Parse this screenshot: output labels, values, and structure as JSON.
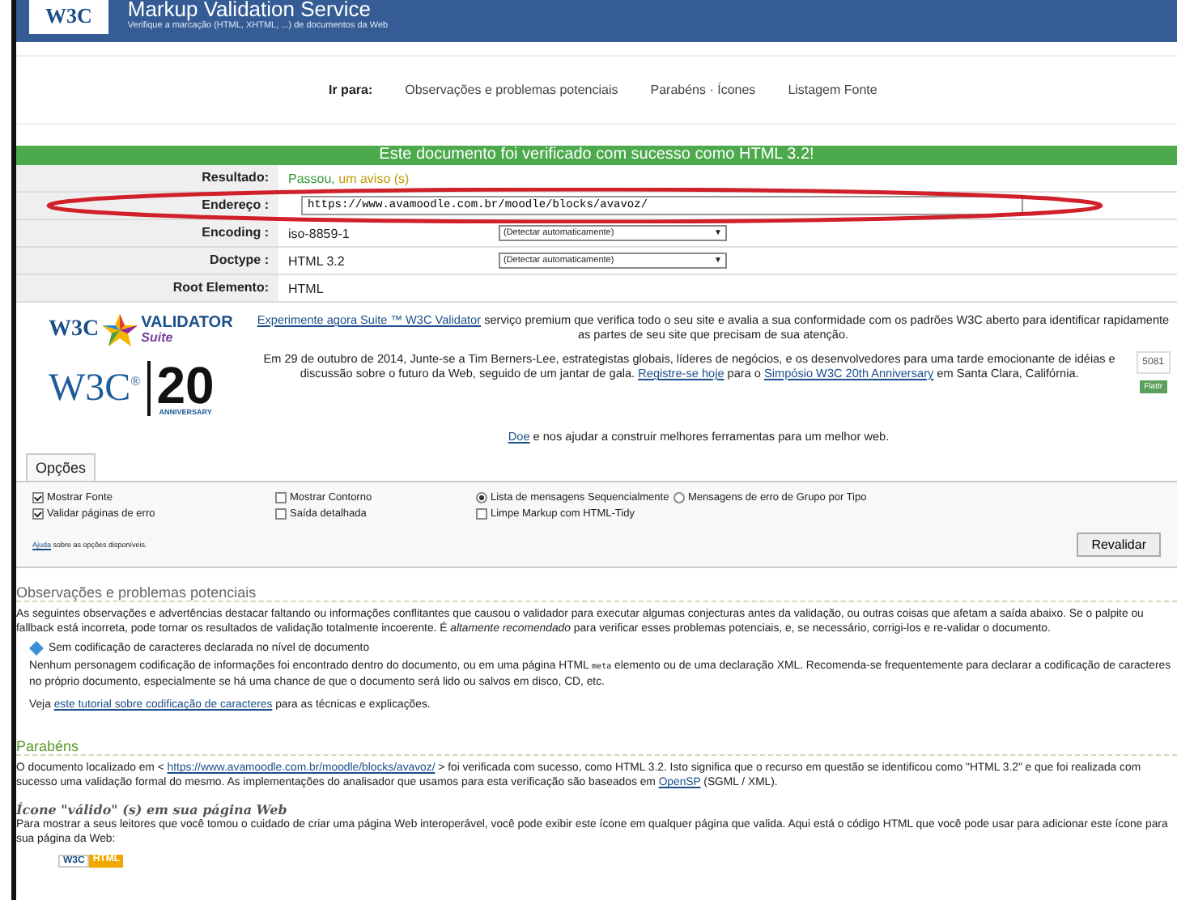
{
  "header": {
    "logo": "W3C",
    "title": "Markup Validation Service",
    "subtitle": "Verifique a marcação (HTML, XHTML, ...) de documentos da Web"
  },
  "jump": {
    "label": "Ir para:",
    "links": [
      "Observações e problemas potenciais",
      "Parabéns · Ícones",
      "Listagem Fonte"
    ]
  },
  "banner": "Este documento foi verificado com sucesso como HTML 3.2!",
  "info_rows": [
    {
      "label": "Resultado:",
      "kind": "result",
      "value": "Passou,",
      "extra": "um aviso (s)"
    },
    {
      "label": "Endereço :",
      "kind": "input",
      "value": "https://www.avamoodle.com.br/moodle/blocks/avavoz/"
    },
    {
      "label": "Encoding :",
      "kind": "select",
      "value": "iso-8859-1",
      "select": "(Detectar automaticamente)",
      "caret": "▼"
    },
    {
      "label": "Doctype :",
      "kind": "select",
      "value": "HTML 3.2",
      "select": "(Detectar automaticamente)",
      "caret": "▼"
    },
    {
      "label": "Root Elemento:",
      "kind": "text",
      "value": "HTML"
    }
  ],
  "promo": {
    "validator_logo": {
      "w3c": "W3C",
      "name": "VALIDATOR",
      "suite": "Suite"
    },
    "validator_text": [
      {
        "t": "Experimente agora Suite ™ W3C Validator",
        "kind": "link"
      },
      {
        "t": " serviço premium que verifica todo o seu site e avalia a sua conformidade com os padrões W3C aberto para identificar rapidamente as partes de seu site que precisam de sua atenção.",
        "kind": "text"
      }
    ],
    "anniversary_logo": {
      "w3c": "W3C",
      "mark": "®",
      "number": "20",
      "caption": "ANNIVERSARY"
    },
    "anniversary_text": [
      {
        "t": "Em 29 de outubro de 2014, Junte-se a Tim Berners-Lee, estrategistas globais, líderes de negócios, e os desenvolvedores para uma tarde emocionante de idéias e discussão sobre o futuro da Web, seguido de um jantar de gala. ",
        "kind": "text"
      },
      {
        "t": "Registre-se hoje",
        "kind": "link"
      },
      {
        "t": " para o ",
        "kind": "text"
      },
      {
        "t": "Simpósio W3C 20th Anniversary",
        "kind": "link"
      },
      {
        "t": " em Santa Clara, Califórnia.",
        "kind": "text"
      }
    ],
    "counter": "5081",
    "flattr": "Flattr",
    "donate": [
      {
        "t": "Doe",
        "kind": "link"
      },
      {
        "t": " e nos ajudar a construir melhores ferramentas para um melhor web.",
        "kind": "text"
      }
    ]
  },
  "options": {
    "legend": "Opções",
    "columns": [
      [
        {
          "kind": "checkbox",
          "label": "Mostrar Fonte",
          "checked": true
        },
        {
          "kind": "checkbox",
          "label": "Validar páginas de erro",
          "checked": true
        }
      ],
      [
        {
          "kind": "checkbox",
          "label": "Mostrar Contorno",
          "checked": false
        },
        {
          "kind": "checkbox",
          "label": "Saída detalhada",
          "checked": false
        }
      ],
      [
        {
          "kind": "radio",
          "label": "Lista de mensagens Sequencialmente",
          "checked": true
        },
        {
          "kind": "checkbox",
          "label": "Limpe Markup com HTML-Tidy",
          "checked": false
        }
      ],
      [
        {
          "kind": "radio",
          "label": "Mensagens de erro de Grupo por Tipo",
          "checked": false
        }
      ]
    ],
    "help": [
      {
        "t": "Ajuda",
        "kind": "link"
      },
      {
        "t": " sobre as opções disponíveis.",
        "kind": "text"
      }
    ],
    "button": "Revalidar"
  },
  "notes": {
    "heading": "Observações e problemas potenciais",
    "intro": "As seguintes observações e advertências destacar faltando ou informações conflitantes que causou o validador para executar algumas conjecturas antes da validação, ou outras coisas que afetam a saída abaixo. Se o palpite ou fallback está incorreta, pode tornar os resultados de validação totalmente incoerente. É *altamente recomendado* para verificar esses problemas potenciais, e, se necessário, corrigi-los e re-validar o documento.",
    "warning": {
      "title": "Sem codificação de caracteres declarada no nível de documento",
      "text": [
        {
          "t": "Nenhum personagem codificação de informações foi encontrado dentro do documento, ou em uma página HTML ",
          "kind": "text"
        },
        {
          "t": "meta",
          "kind": "code"
        },
        {
          "t": " elemento ou de uma declaração XML. Recomenda-se frequentemente para declarar a codificação de caracteres no próprio documento, especialmente se há uma chance de que o documento será lido ou salvos em disco, CD, etc.",
          "kind": "text"
        }
      ],
      "see": [
        {
          "t": "Veja ",
          "kind": "text"
        },
        {
          "t": "este tutorial sobre codificação de caracteres",
          "kind": "link"
        },
        {
          "t": " para as técnicas e explicações.",
          "kind": "text"
        }
      ]
    }
  },
  "congrats": {
    "heading": "Parabéns",
    "text": [
      {
        "t": "O documento localizado em < ",
        "kind": "text"
      },
      {
        "t": "https://www.avamoodle.com.br/moodle/blocks/avavoz/",
        "kind": "link"
      },
      {
        "t": " > foi verificada com sucesso, como HTML 3.2. Isto significa que o recurso em questão se identificou como \"HTML 3.2\" e que foi realizada com sucesso uma validação formal do mesmo. As implementações do analisador que usamos para esta verificação são baseados em ",
        "kind": "text"
      },
      {
        "t": "OpenSP",
        "kind": "link"
      },
      {
        "t": " (SGML / XML).",
        "kind": "text"
      }
    ],
    "icon_heading": "Ícone \"válido\" (s) em sua página Web",
    "icon_text": "Para mostrar a seus leitores que você tomou o cuidado de criar uma página Web interoperável, você pode exibir este ícone em qualquer página que valida. Aqui está o código HTML que você pode usar para adicionar este ícone para sua página da Web:",
    "badge": {
      "w3c": "W3C",
      "html": "HTML"
    }
  }
}
